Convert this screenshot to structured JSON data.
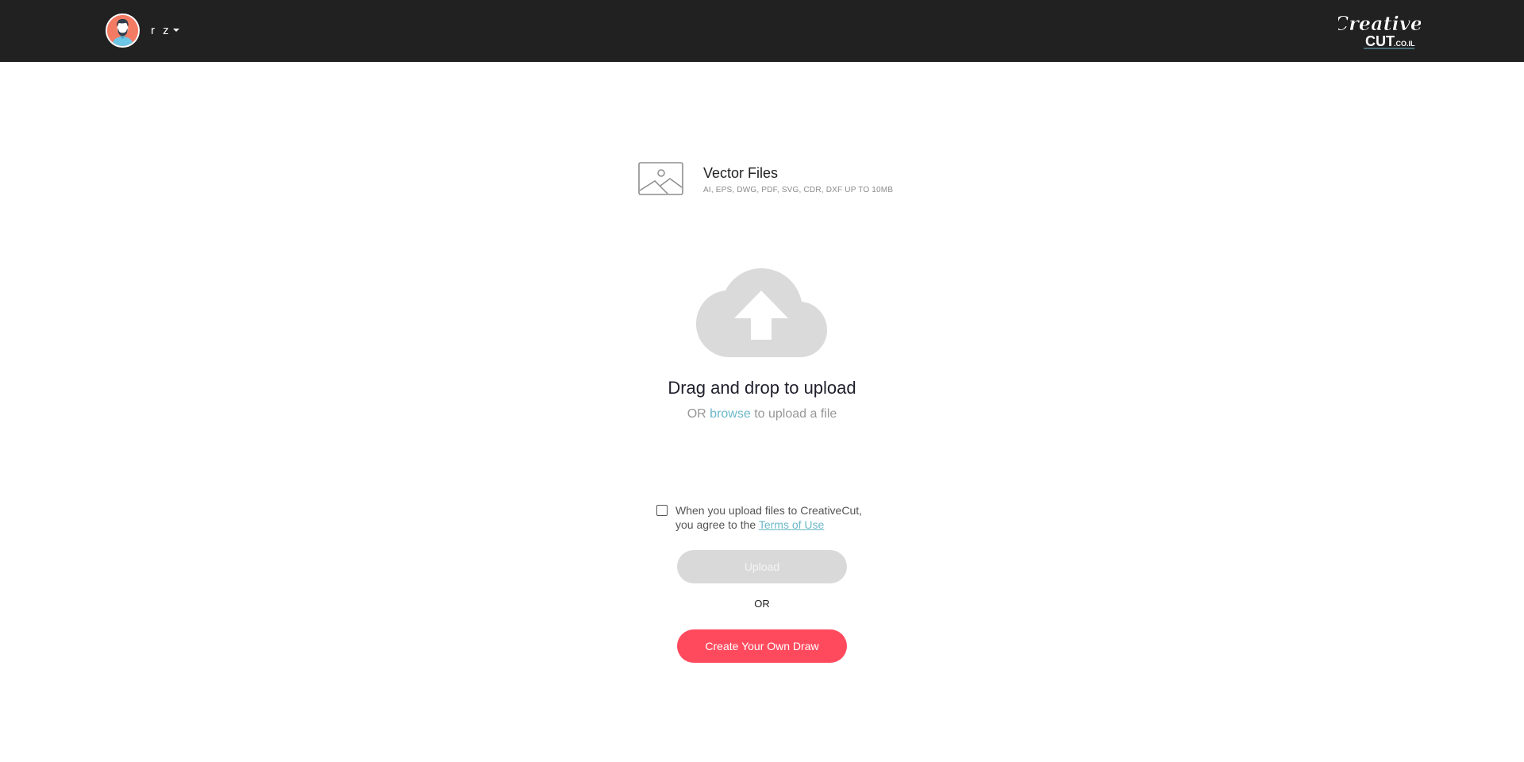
{
  "header": {
    "user": {
      "name": "r z",
      "avatar_icon": "user-avatar-icon",
      "menu_icon": "caret-down-icon"
    },
    "logo": {
      "line1": "Creative",
      "line2": "CUT",
      "suffix": ".CO.IL"
    }
  },
  "file_type": {
    "icon": "image-icon",
    "title": "Vector Files",
    "subtitle": "AI, EPS, DWG, PDF, SVG, CDR, DXF UP TO 10MB"
  },
  "dropzone": {
    "icon": "cloud-upload-icon",
    "title": "Drag and drop to upload",
    "sub_prefix": "OR",
    "browse_label": "browse",
    "sub_suffix": "to upload a file"
  },
  "agreement": {
    "checked": false,
    "line1": "When you upload files to CreativeCut,",
    "line2_prefix": "you agree to the",
    "terms_label": "Terms of Use"
  },
  "actions": {
    "upload_label": "Upload",
    "upload_enabled": false,
    "or_label": "OR",
    "create_label": "Create Your Own Draw"
  },
  "colors": {
    "header_bg": "#212121",
    "accent_link": "#6cb8c9",
    "primary_red": "#ff4a5e",
    "disabled_gray": "#d9d9d9",
    "avatar_bg": "#f47b63"
  }
}
